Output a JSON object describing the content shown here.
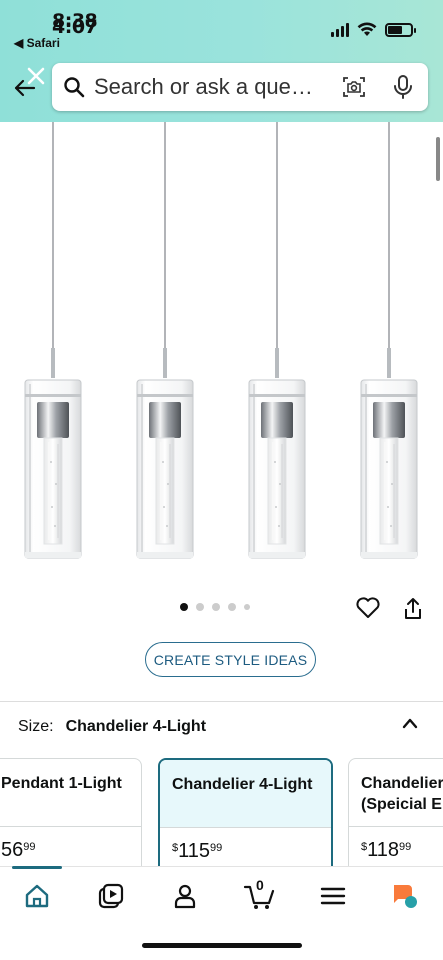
{
  "status_bar": {
    "time_top": "8:38",
    "time_bottom": "4:07",
    "back_app_label": "◀ Safari"
  },
  "search": {
    "placeholder": "Search or ask a que…"
  },
  "carousel": {
    "image_count": 5,
    "active_index": 0
  },
  "actions": {
    "style_ideas_label": "CREATE STYLE IDEAS"
  },
  "size_selector": {
    "label": "Size:",
    "value": "Chandelier 4-Light",
    "options": [
      {
        "title": "Pendant 1-Light",
        "price_currency": "",
        "price_whole": "56",
        "price_cents": "99",
        "selected": false
      },
      {
        "title": "Chandelier 4-Light",
        "price_currency": "$",
        "price_whole": "115",
        "price_cents": "99",
        "selected": true
      },
      {
        "title": "Chandelier\n(Speicial E",
        "title_line1": "Chandelier",
        "title_line2": "(Speicial E",
        "price_currency": "$",
        "price_whole": "118",
        "price_cents": "99",
        "selected": false
      }
    ]
  },
  "bottom_nav": {
    "items": [
      "home-icon",
      "video-icon",
      "account-icon",
      "cart-icon",
      "menu-icon",
      "ai-assistant-icon"
    ],
    "cart_count": "0"
  },
  "colors": {
    "header_bg": "#9ae3dc",
    "accent_teal": "#1d6b7f",
    "style_button": "#1d5b80",
    "selected_card_bg": "#e7f8fb",
    "ai_orange": "#f97a3b"
  }
}
